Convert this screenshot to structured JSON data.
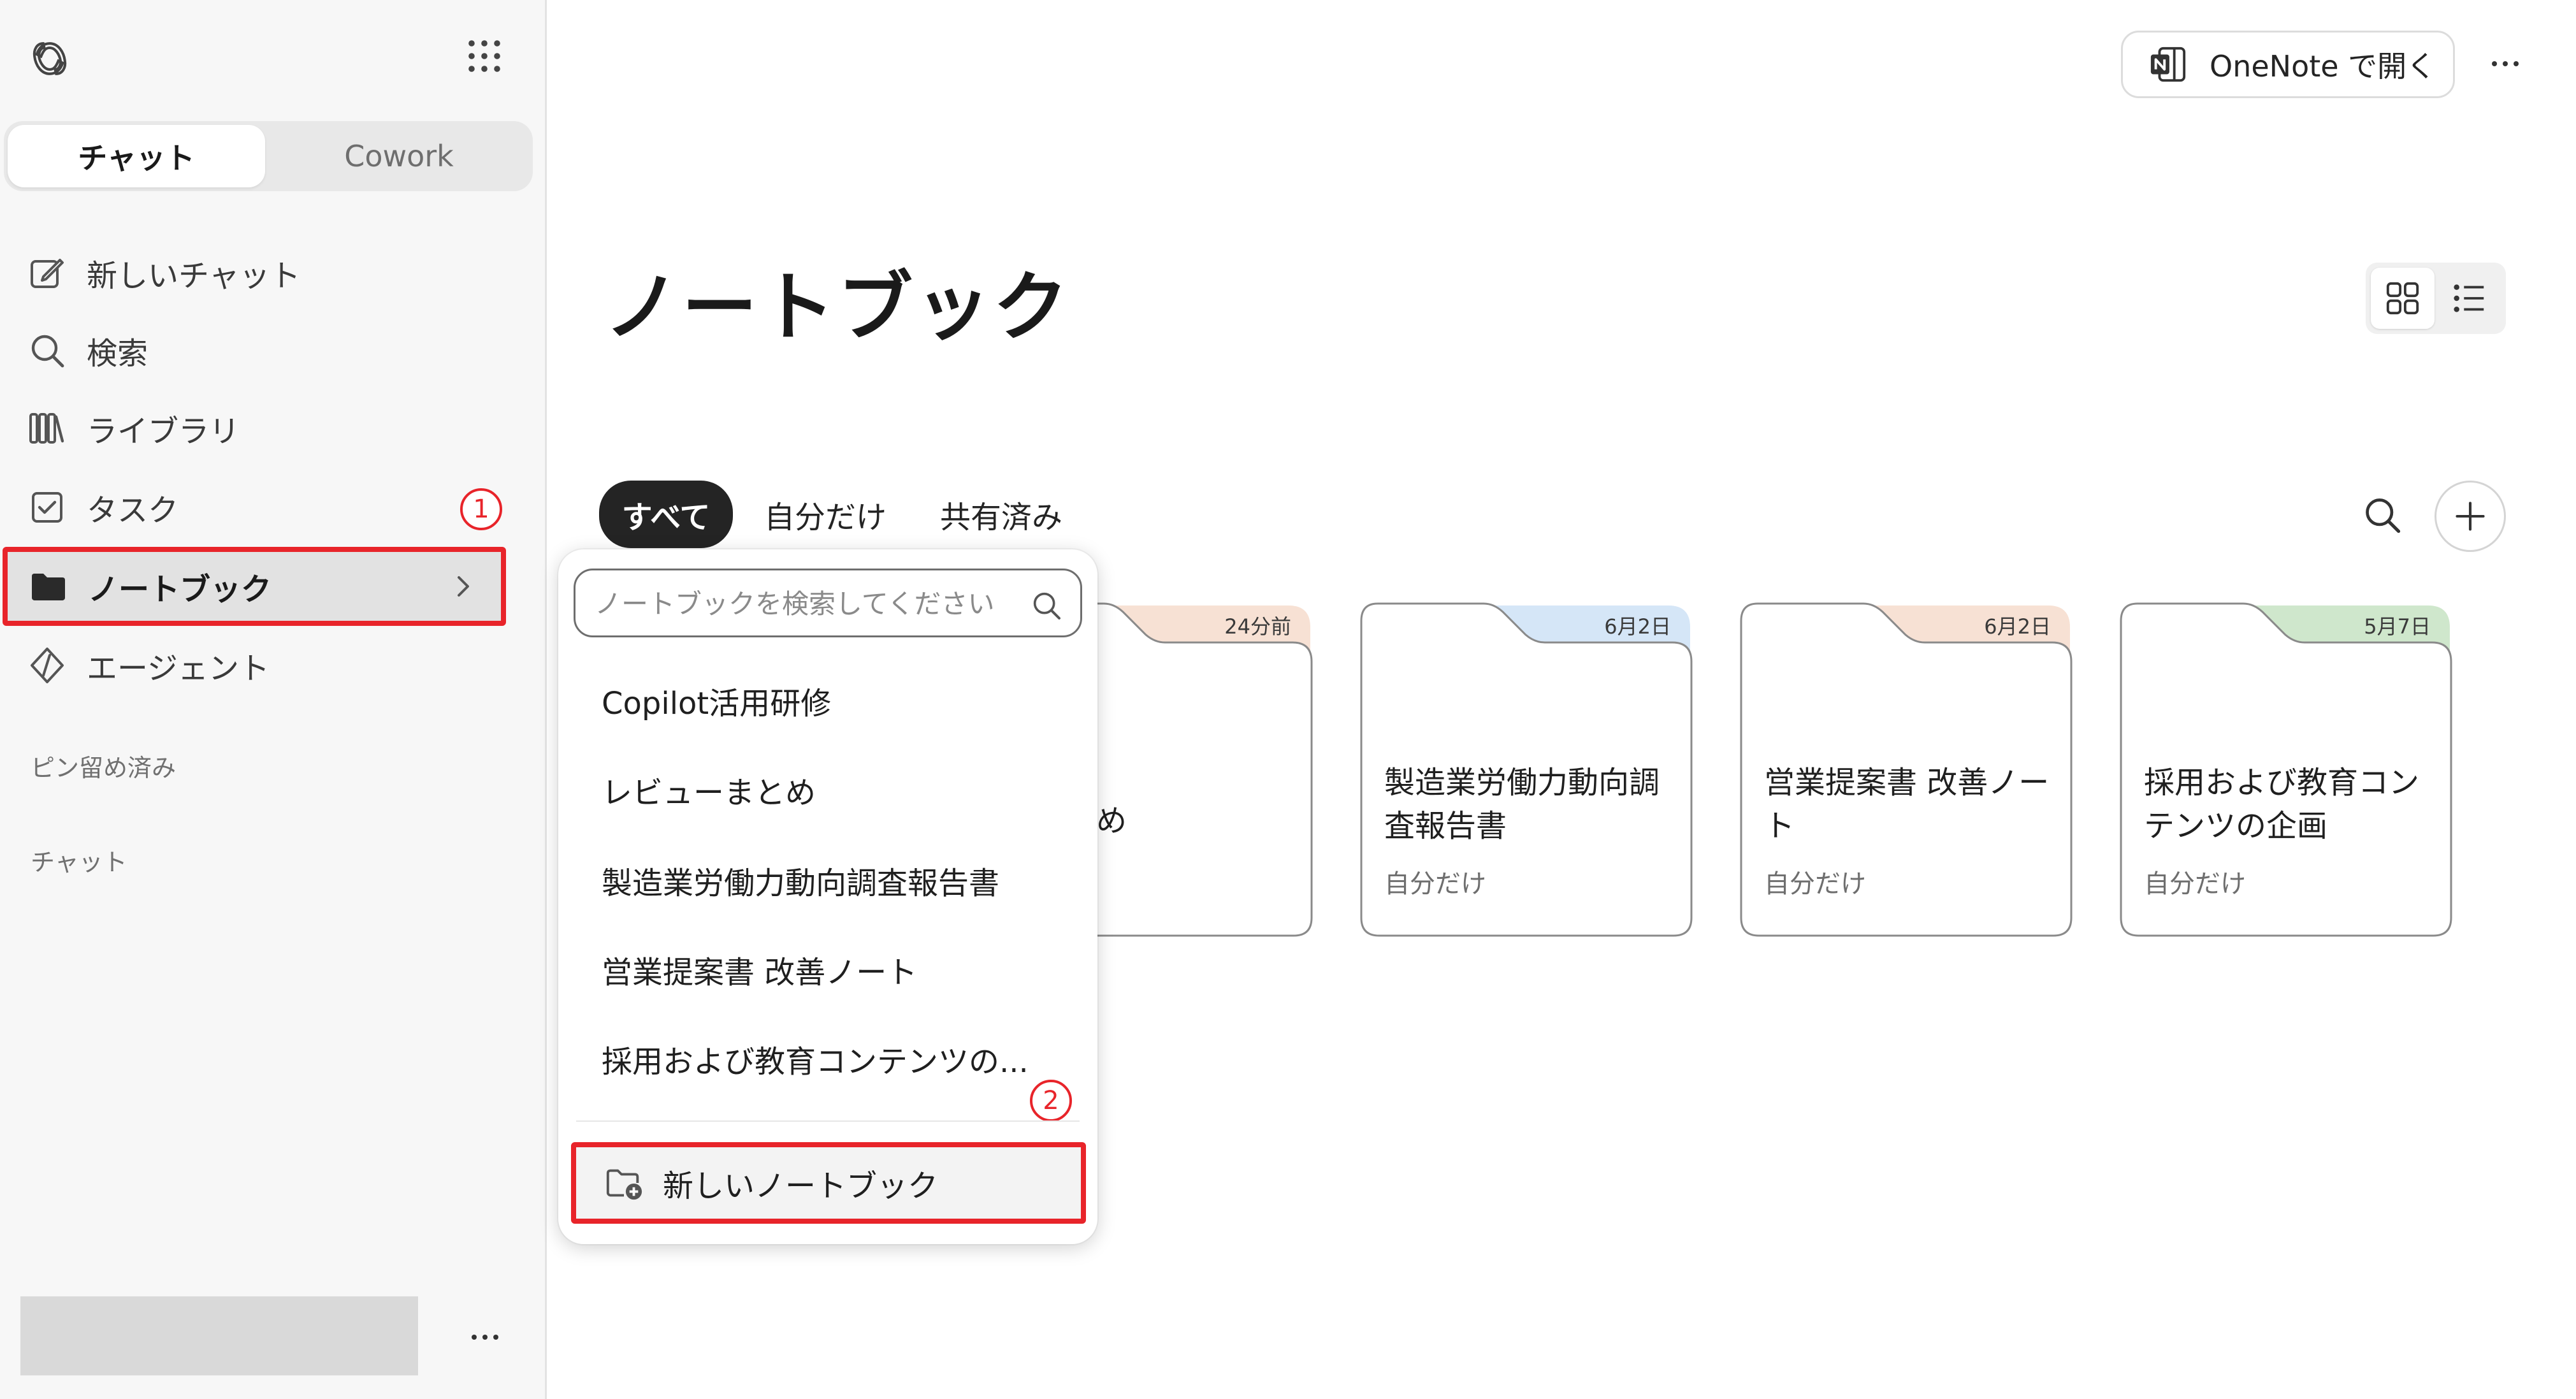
{
  "sidebar": {
    "segment": {
      "chat": "チャット",
      "cowork": "Cowork"
    },
    "items": [
      {
        "label": "新しいチャット",
        "icon": "compose-icon"
      },
      {
        "label": "検索",
        "icon": "search-icon"
      },
      {
        "label": "ライブラリ",
        "icon": "library-icon"
      },
      {
        "label": "タスク",
        "icon": "task-checkbox-icon"
      },
      {
        "label": "ノートブック",
        "icon": "folder-icon"
      },
      {
        "label": "エージェント",
        "icon": "agent-icon"
      }
    ],
    "sections": {
      "pinned": "ピン留め済み",
      "chats": "チャット"
    }
  },
  "markers": {
    "first": "1",
    "second": "2"
  },
  "header": {
    "open_onenote": "OneNote で開く"
  },
  "main": {
    "title": "ノートブック",
    "filters": [
      "すべて",
      "自分だけ",
      "共有済み"
    ]
  },
  "cards": [
    {
      "date": "24分前",
      "title": "ーまとめ",
      "sub": "け",
      "tab_color": "#f7e1d4"
    },
    {
      "date": "6月2日",
      "title": "製造業労働力動向調査報告書",
      "sub": "自分だけ",
      "tab_color": "#d5e6f7"
    },
    {
      "date": "6月2日",
      "title": "営業提案書 改善ノート",
      "sub": "自分だけ",
      "tab_color": "#f7e1d4"
    },
    {
      "date": "5月7日",
      "title": "採用および教育コンテンツの企画",
      "sub": "自分だけ",
      "tab_color": "#cfe7cc"
    }
  ],
  "dropdown": {
    "search_placeholder": "ノートブックを検索してください",
    "items": [
      "Copilot活用研修",
      "レビューまとめ",
      "製造業労働力動向調査報告書",
      "営業提案書 改善ノート",
      "採用および教育コンテンツの..."
    ],
    "new_notebook": "新しいノートブック"
  },
  "colors": {
    "highlight_red": "#e8242a",
    "active_tab": "#242424"
  }
}
